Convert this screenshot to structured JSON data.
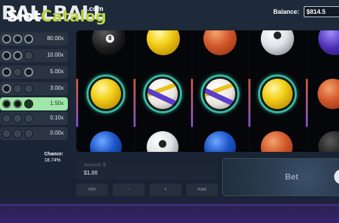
{
  "header": {
    "game_title": "BALLBALL",
    "watermark_slot": "Slot",
    "watermark_catalog": "Catalog",
    "watermark_com": ".com",
    "balance_label": "Balance:",
    "balance_value": "$814.5"
  },
  "paytable": {
    "rows": [
      {
        "hits": 0,
        "multiplier": "80.00x",
        "active": false
      },
      {
        "hits": 1,
        "multiplier": "10.00x",
        "active": false
      },
      {
        "hits": 2,
        "multiplier": "5.00x",
        "active": false
      },
      {
        "hits": 1,
        "multiplier": "3.00x",
        "active": false
      },
      {
        "hits": 2,
        "multiplier": "1.50x",
        "active": true
      },
      {
        "hits": 0,
        "multiplier": "0.10x",
        "active": false
      },
      {
        "hits": 0,
        "multiplier": "0.00x",
        "active": false
      }
    ],
    "chance_label": "Chance:",
    "chance_value": "18.74%"
  },
  "reels": {
    "win_line_symbols": [
      "yellow-ball",
      "volleyball",
      "volleyball",
      "yellow-ball",
      "basketball"
    ]
  },
  "controls": {
    "amount_label": "Amount: $",
    "amount_value": "$1.00",
    "min_label": "min",
    "minus_label": "-",
    "plus_label": "+",
    "max_label": "max",
    "bet_label": "Bet"
  },
  "colors": {
    "active_row": "#9fe6a8",
    "win_ring": "#39b9a0",
    "logo_accent": "#b8d14a"
  }
}
